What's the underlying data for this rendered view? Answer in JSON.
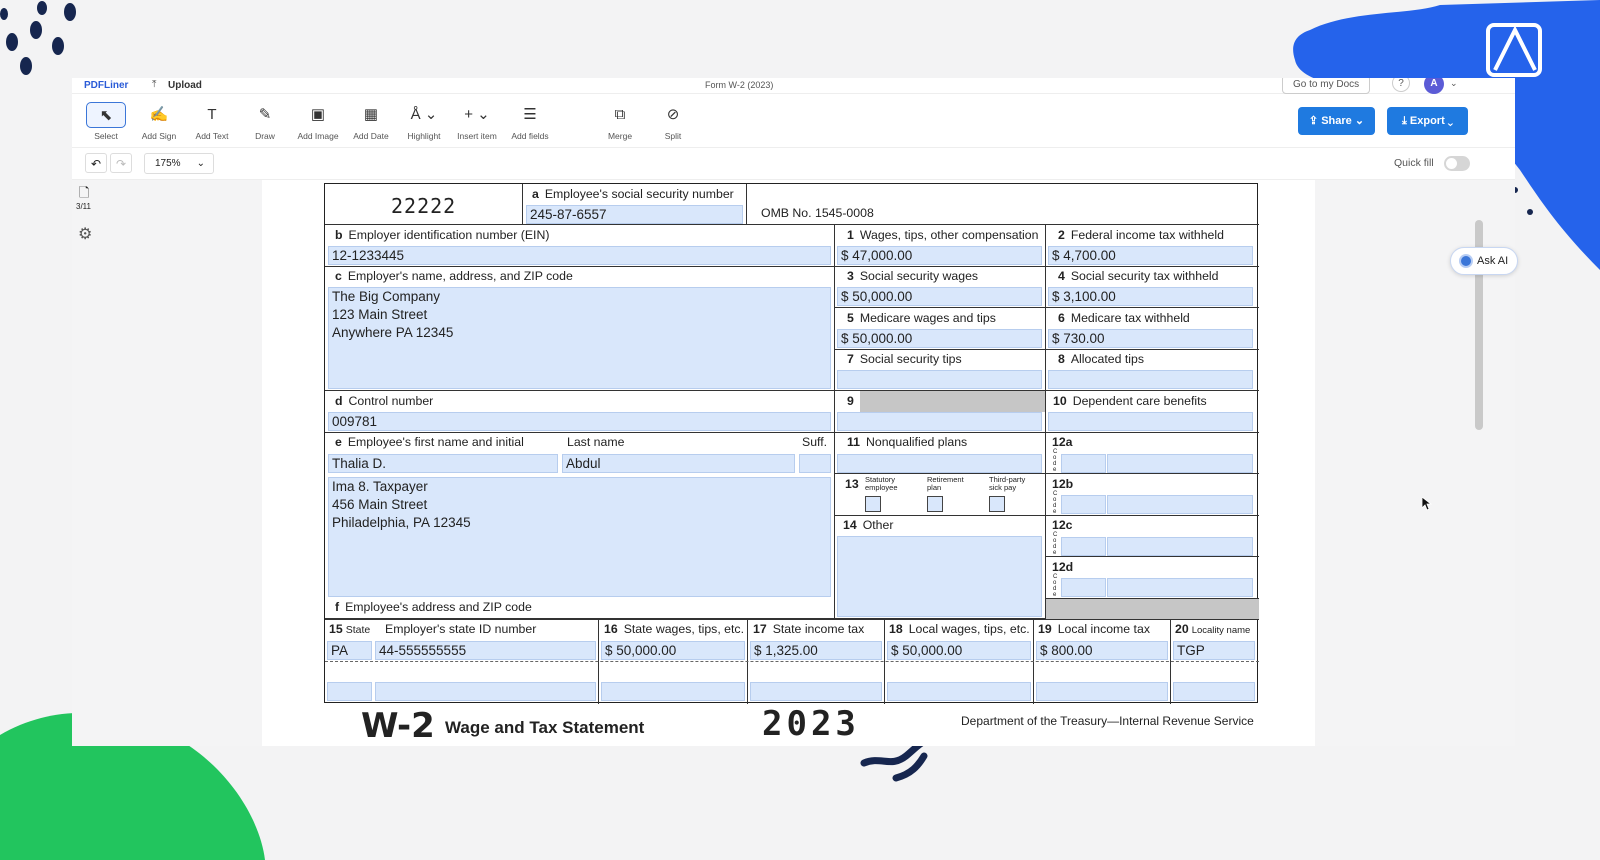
{
  "app": {
    "logo": "PDFLiner",
    "upload_label": "Upload",
    "doc_title": "Form W-2 (2023)",
    "go_to_docs_label": "Go to my Docs",
    "help_label": "?",
    "avatar_letter": "A",
    "share_label": "Share",
    "export_label": "Export",
    "zoom": "175%",
    "quick_fill_label": "Quick fill",
    "page_counter": "3/11",
    "ask_ai_label": "Ask AI",
    "accent_color": "#1f7ae0"
  },
  "toolbar": {
    "select": "Select",
    "add_sign": "Add Sign",
    "add_text": "Add Text",
    "draw": "Draw",
    "add_image": "Add Image",
    "add_date": "Add Date",
    "highlight": "Highlight",
    "insert_item": "Insert item",
    "add_fields": "Add fields",
    "merge": "Merge",
    "split": "Split"
  },
  "w2": {
    "code": "22222",
    "a_num": "a",
    "a_label": "Employee's social security number",
    "a_value": "245-87-6557",
    "omb": "OMB No. 1545-0008",
    "b_num": "b",
    "b_label": "Employer identification number (EIN)",
    "b_value": "12-1233445",
    "c_num": "c",
    "c_label": "Employer's name, address, and ZIP code",
    "c_value": "The Big Company\n123 Main Street\nAnywhere PA 12345",
    "d_num": "d",
    "d_label": "Control number",
    "d_value": "009781",
    "e_num": "e",
    "e_label": "Employee's first name and initial",
    "e_value": "Thalia D.",
    "last_label": "Last name",
    "last_value": "Abdul",
    "suff_label": "Suff.",
    "address_value": "Ima 8. Taxpayer\n456 Main Street\nPhiladelphia, PA 12345",
    "f_num": "f",
    "f_label": "Employee's address and ZIP code",
    "b1_num": "1",
    "b1_label": "Wages, tips, other compensation",
    "b1_value": "$ 47,000.00",
    "b2_num": "2",
    "b2_label": "Federal income tax withheld",
    "b2_value": "$ 4,700.00",
    "b3_num": "3",
    "b3_label": "Social security wages",
    "b3_value": "$ 50,000.00",
    "b4_num": "4",
    "b4_label": "Social security tax withheld",
    "b4_value": "$ 3,100.00",
    "b5_num": "5",
    "b5_label": "Medicare wages and tips",
    "b5_value": "$ 50,000.00",
    "b6_num": "6",
    "b6_label": "Medicare tax withheld",
    "b6_value": "$ 730.00",
    "b7_num": "7",
    "b7_label": "Social security tips",
    "b8_num": "8",
    "b8_label": "Allocated tips",
    "b9_num": "9",
    "b10_num": "10",
    "b10_label": "Dependent care benefits",
    "b11_num": "11",
    "b11_label": "Nonqualified plans",
    "b12a": "12a",
    "b12b": "12b",
    "b12c": "12c",
    "b12d": "12d",
    "code_letters": "C o d e",
    "b13_num": "13",
    "statutory_label": "Statutory employee",
    "retirement_label": "Retirement plan",
    "thirdparty_label": "Third-party sick pay",
    "b14_num": "14",
    "b14_label": "Other",
    "b15_num": "15",
    "b15_label": "State",
    "state_id_label": "Employer's state ID number",
    "b16_num": "16",
    "b16_label": "State wages, tips, etc.",
    "b17_num": "17",
    "b17_label": "State income tax",
    "b18_num": "18",
    "b18_label": "Local wages, tips, etc.",
    "b19_num": "19",
    "b19_label": "Local income tax",
    "b20_num": "20",
    "b20_label": "Locality name",
    "state_value": "PA",
    "state_id_value": "44-555555555",
    "b16_value": "$ 50,000.00",
    "b17_value": "$ 1,325.00",
    "b18_value": "$ 50,000.00",
    "b19_value": "$ 800.00",
    "b20_value": "TGP",
    "form_name": "W-2",
    "form_title": "Wage and Tax Statement",
    "year": "2023",
    "department": "Department of the Treasury—Internal Revenue Service"
  }
}
